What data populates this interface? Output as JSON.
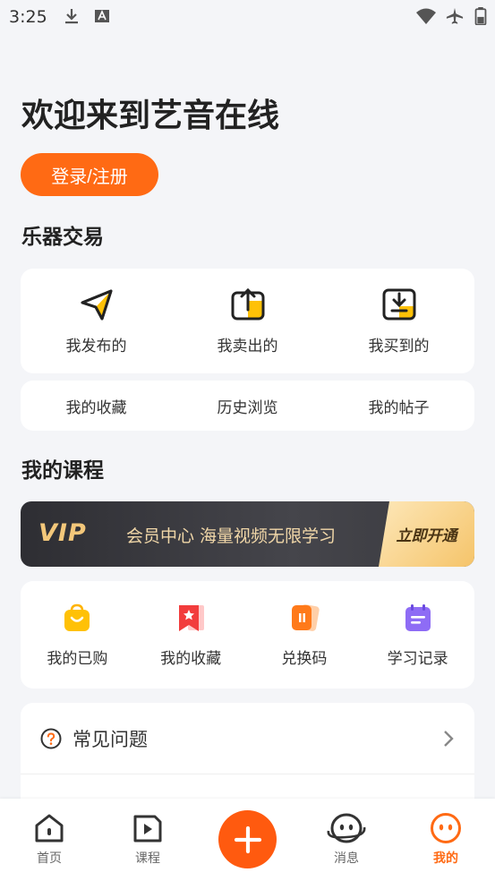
{
  "status_bar": {
    "time": "3:25"
  },
  "welcome_title": "欢迎来到艺音在线",
  "login_button": "登录/注册",
  "section_trade": "乐器交易",
  "trade_actions": [
    {
      "label": "我发布的",
      "icon": "send-icon"
    },
    {
      "label": "我卖出的",
      "icon": "upload-box-icon"
    },
    {
      "label": "我买到的",
      "icon": "download-box-icon"
    }
  ],
  "trade_links": [
    "我的收藏",
    "历史浏览",
    "我的帖子"
  ],
  "section_courses": "我的课程",
  "vip": {
    "logo": "VIP",
    "text": "会员中心 海量视频无限学习",
    "cta": "立即开通"
  },
  "course_actions": [
    {
      "label": "我的已购",
      "icon": "shopping-bag-icon"
    },
    {
      "label": "我的收藏",
      "icon": "bookmark-star-icon"
    },
    {
      "label": "兑换码",
      "icon": "coupon-icon"
    },
    {
      "label": "学习记录",
      "icon": "notebook-icon"
    }
  ],
  "faq": {
    "label": "常见问题"
  },
  "tabs": [
    {
      "label": "首页",
      "icon": "home-icon"
    },
    {
      "label": "课程",
      "icon": "play-icon"
    },
    {
      "label": "消息",
      "icon": "message-face-icon"
    },
    {
      "label": "我的",
      "icon": "profile-face-icon",
      "active": true
    }
  ],
  "colors": {
    "accent": "#ff6a14",
    "yellow": "#ffc107",
    "vip_gold": "#f3c77a"
  }
}
